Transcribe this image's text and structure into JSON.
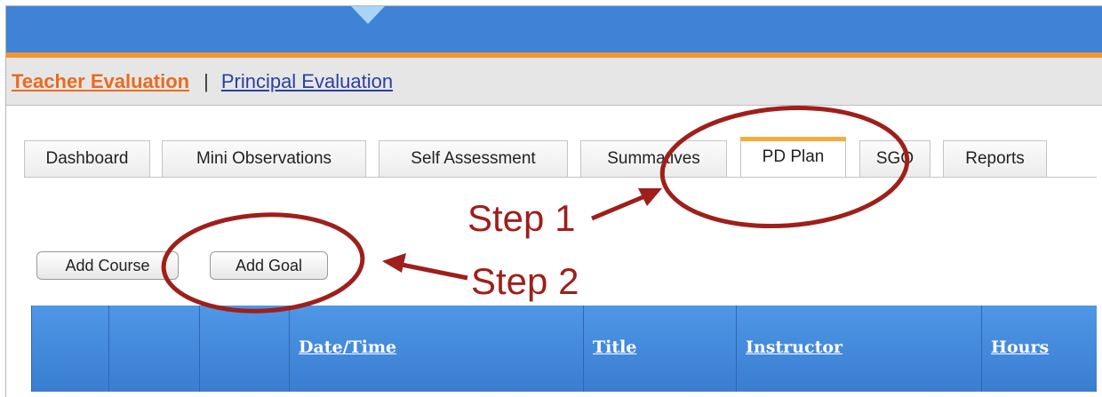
{
  "colors": {
    "topbar": "#3f82d6",
    "accent_orange": "#f29433",
    "grid_header": "#3f82d6",
    "annotation": "#9e1f1b"
  },
  "eval_nav": {
    "teacher_label": "Teacher Evaluation",
    "separator": "|",
    "principal_label": "Principal Evaluation"
  },
  "tabs": [
    {
      "label": "Dashboard",
      "active": false
    },
    {
      "label": "Mini Observations",
      "active": false
    },
    {
      "label": "Self Assessment",
      "active": false
    },
    {
      "label": "Summatives",
      "active": false
    },
    {
      "label": "PD Plan",
      "active": true
    },
    {
      "label": "SGO",
      "active": false
    },
    {
      "label": "Reports",
      "active": false
    }
  ],
  "actions": {
    "add_course_label": "Add Course",
    "add_goal_label": "Add Goal"
  },
  "table": {
    "columns": [
      "",
      "",
      "",
      "Date/Time",
      "Title",
      "Instructor",
      "Hours"
    ]
  },
  "annotations": {
    "step1": "Step 1",
    "step2": "Step 2"
  }
}
